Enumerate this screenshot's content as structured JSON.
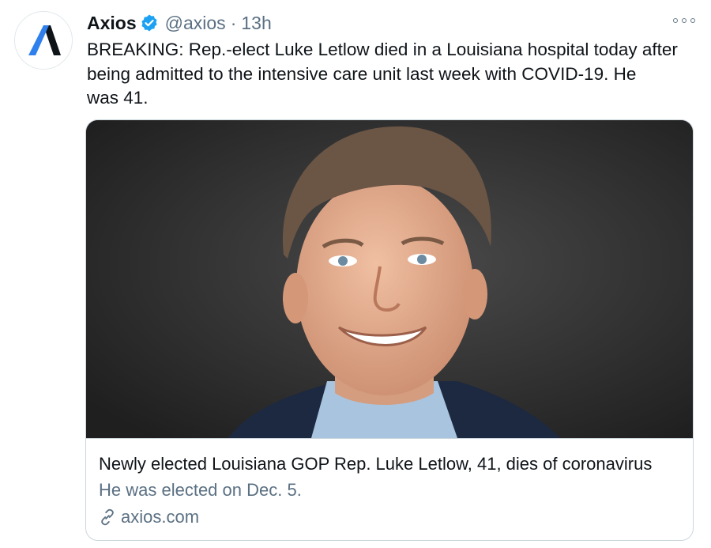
{
  "account": {
    "name": "Axios",
    "handle": "@axios",
    "separator": "·",
    "time": "13h",
    "avatar_icon": "axios-logo-icon",
    "verified_icon": "verified-badge-icon",
    "accent_color": "#1da1f2"
  },
  "tweet": {
    "text": "BREAKING: Rep.-elect Luke Letlow died in a Louisiana hospital today after\nbeing admitted to the intensive care unit last week with COVID-19. He\nwas 41."
  },
  "card": {
    "image_alt": "Portrait photo",
    "title": "Newly elected Louisiana GOP Rep. Luke Letlow, 41, dies of coronavirus",
    "description": "He was elected on Dec. 5.",
    "domain": "axios.com",
    "link_icon": "link-icon"
  },
  "menu": {
    "more_icon": "more-options-icon"
  }
}
